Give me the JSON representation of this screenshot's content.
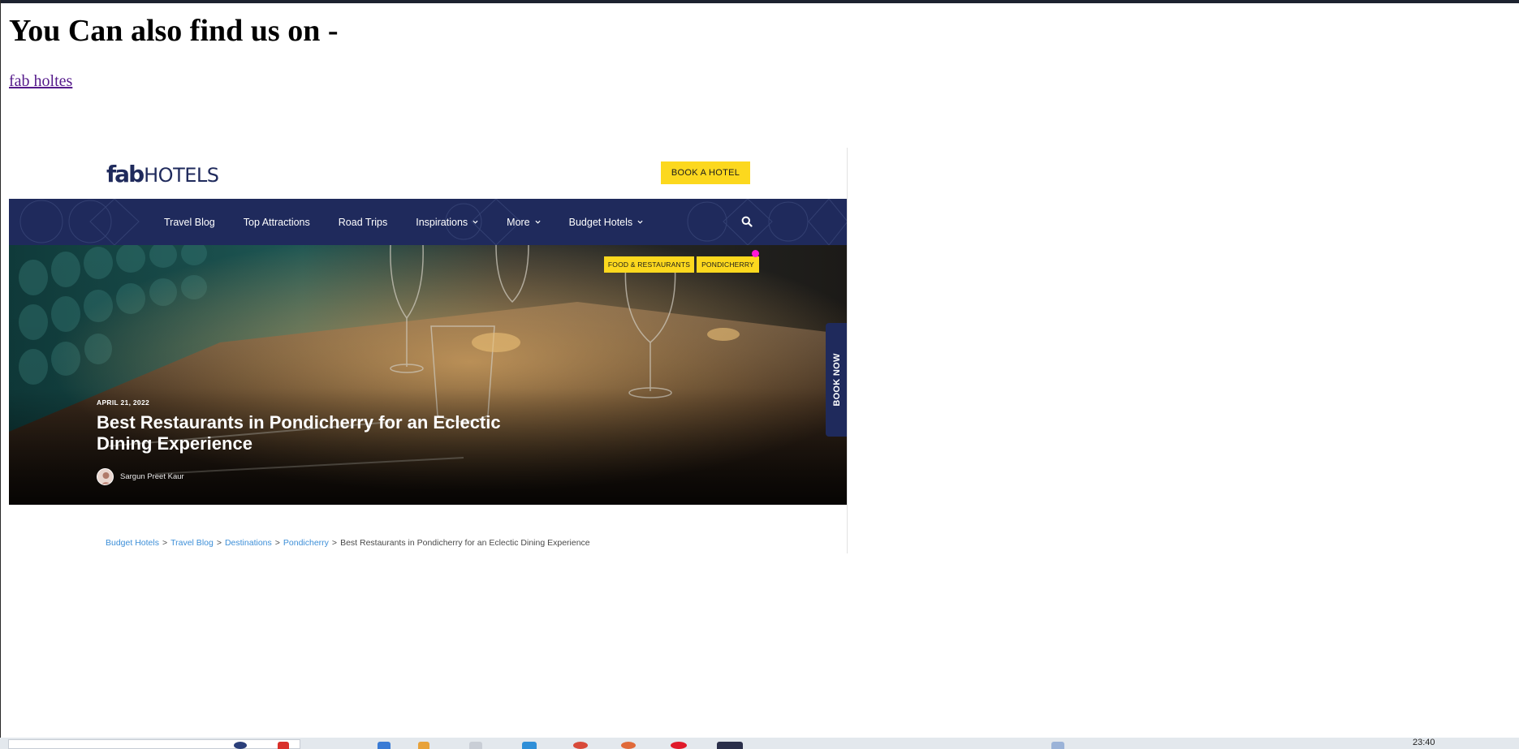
{
  "page": {
    "heading": "You Can also find us on -",
    "link_text": "fab holtes"
  },
  "site_header": {
    "logo_fab": "fab",
    "logo_hotels": "HOTELS",
    "book_hotel_label": "BOOK A HOTEL"
  },
  "nav": {
    "items": [
      {
        "label": "Travel Blog",
        "has_dropdown": false
      },
      {
        "label": "Top Attractions",
        "has_dropdown": false
      },
      {
        "label": "Road Trips",
        "has_dropdown": false
      },
      {
        "label": "Inspirations",
        "has_dropdown": true
      },
      {
        "label": "More",
        "has_dropdown": true
      },
      {
        "label": "Budget Hotels",
        "has_dropdown": true
      }
    ],
    "search_icon": "search-icon"
  },
  "hero": {
    "tags": [
      "FOOD & RESTAURANTS",
      "PONDICHERRY"
    ],
    "date": "APRIL 21, 2022",
    "title": "Best Restaurants in Pondicherry for an Eclectic Dining Experience",
    "author": "Sargun Preet Kaur",
    "book_now_label": "BOOK NOW"
  },
  "breadcrumb": {
    "links": [
      "Budget Hotels",
      "Travel Blog",
      "Destinations",
      "Pondicherry"
    ],
    "separator": ">",
    "current": "Best Restaurants in Pondicherry for an Eclectic Dining Experience"
  },
  "taskbar": {
    "time": "23:40"
  },
  "colors": {
    "brand_navy": "#1f2a5c",
    "brand_yellow": "#fcd81e",
    "link_blue": "#3d8fd8",
    "visited_link": "#551a8b",
    "notification_dot": "#ff17d8"
  }
}
